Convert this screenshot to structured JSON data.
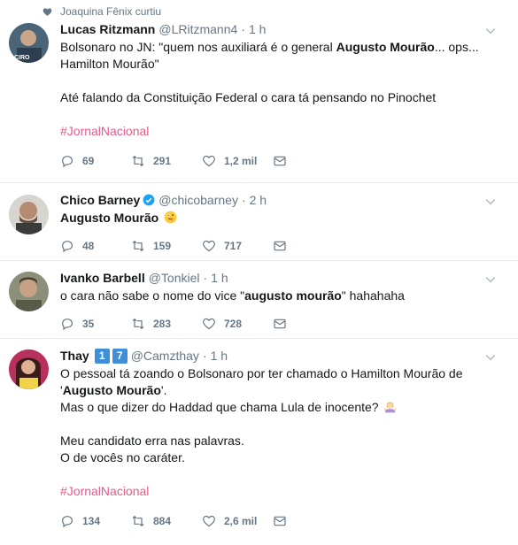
{
  "social_context": {
    "text": "Joaquina Fênix curtiu"
  },
  "tweets": [
    {
      "name": "Lucas Ritzmann",
      "handle": "@LRitzmann4",
      "separator": "·",
      "time": "1 h",
      "avatar_label": "CIRO",
      "lines": [
        [
          "Bolsonaro no JN: \"quem nos auxiliará é o general ",
          "Augusto Mourão",
          "... ops..."
        ],
        [
          "Hamilton Mourão\""
        ],
        [
          ""
        ],
        [
          "Até falando da Constituição Federal o cara tá pensando no Pinochet"
        ],
        [
          ""
        ],
        [
          "#JornalNacional"
        ]
      ],
      "replies": "69",
      "retweets": "291",
      "likes": "1,2 mil"
    },
    {
      "name": "Chico Barney",
      "handle": "@chicobarney",
      "separator": "·",
      "time": "2 h",
      "lines": [
        [
          "Augusto Mourão"
        ]
      ],
      "emoji": "zany-face-emoji",
      "replies": "48",
      "retweets": "159",
      "likes": "717"
    },
    {
      "name": "Ivanko Barbell",
      "handle": "@Tonkiel",
      "separator": "·",
      "time": "1 h",
      "lines": [
        [
          "o cara não sabe o nome do vice \"",
          "augusto mourão",
          "\" hahahaha"
        ]
      ],
      "replies": "35",
      "retweets": "283",
      "likes": "728"
    },
    {
      "name": "Thay",
      "badge1": "1",
      "badge2": "7",
      "handle": "@Camzthay",
      "separator": "·",
      "time": "1 h",
      "lines": [
        [
          "O pessoal tá zoando o Bolsonaro por ter chamado o Hamilton Mourão de"
        ],
        [
          "'",
          "Augusto Mourão",
          "'."
        ],
        [
          "Mas o que dizer do Haddad que chama Lula de inocente?"
        ],
        [
          ""
        ],
        [
          "Meu candidato erra nas palavras."
        ],
        [
          "O de vocês no caráter."
        ],
        [
          ""
        ],
        [
          "#JornalNacional"
        ]
      ],
      "emoji": "woman-shrugging-emoji",
      "replies": "134",
      "retweets": "884",
      "likes": "2,6 mil"
    }
  ],
  "colors": {
    "hashtag": "#e8598b",
    "muted": "#657786",
    "verified": "#1da1f2",
    "badge": "#3d8fd8"
  }
}
